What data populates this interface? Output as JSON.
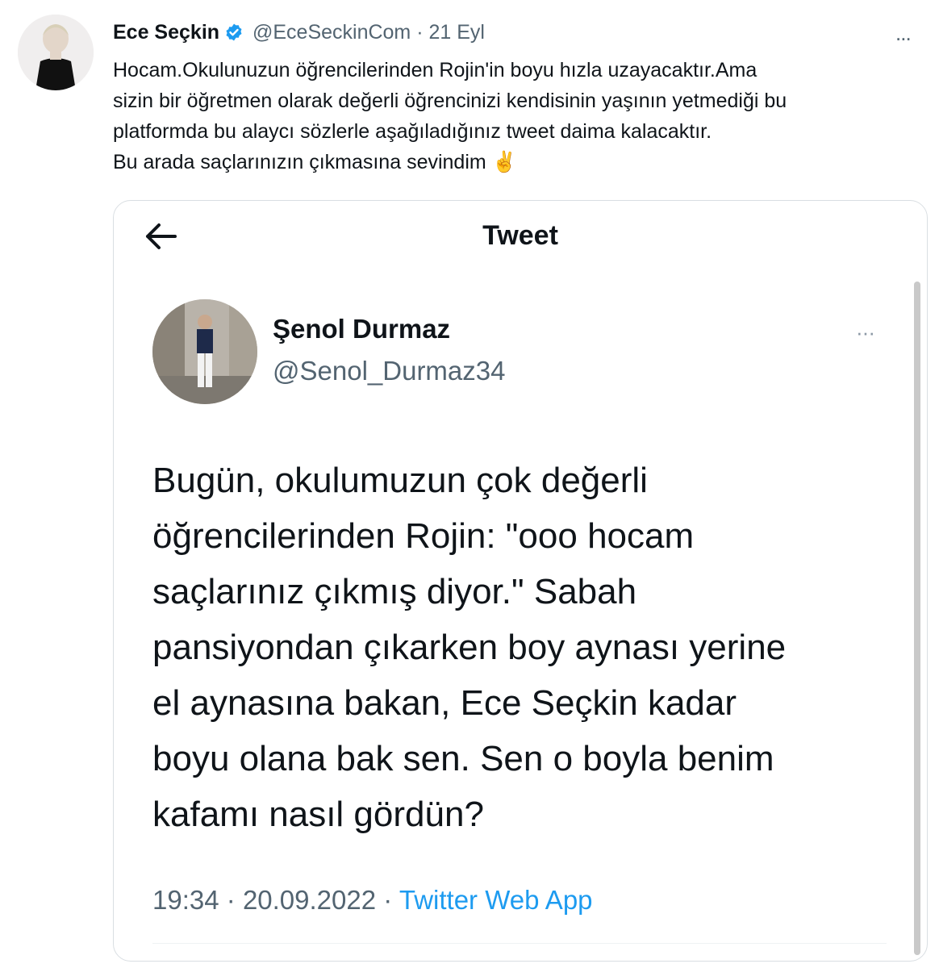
{
  "tweet": {
    "author_name": "Ece Seçkin",
    "handle": "@EceSeckinCom",
    "separator": "·",
    "date": "21 Eyl",
    "more_icon": "...",
    "lines": [
      "Hocam.Okulunuzun  öğrencilerinden Rojin'in boyu hızla uzayacaktır.Ama",
      "sizin bir öğretmen olarak değerli öğrencinizi kendisinin yaşının yetmediği bu",
      "platformda bu alaycı sözlerle aşağıladığınız tweet daima kalacaktır.",
      "Bu arada saçlarınızın çıkmasına sevindim ✌️"
    ]
  },
  "quoted": {
    "page_title": "Tweet",
    "author_name": "Şenol Durmaz",
    "handle": "@Senol_Durmaz34",
    "more_icon": "···",
    "lines": [
      "Bugün, okulumuzun çok değerli",
      "öğrencilerinden Rojin: \"ooo hocam",
      "saçlarınız çıkmış diyor.\" Sabah",
      "pansiyondan çıkarken boy aynası yerine",
      "el aynasına bakan, Ece Seçkin kadar",
      "boyu olana bak sen. Sen o boyla benim",
      "kafamı nasıl gördün?"
    ],
    "time": "19:34",
    "separator": "·",
    "date": "20.09.2022",
    "source": "Twitter Web App"
  },
  "colors": {
    "verified_badge": "#1d9bf0",
    "link": "#1d9bf0",
    "muted_text": "#536471",
    "border": "#d9dee2"
  },
  "icons": {
    "verified": "verified-badge-icon",
    "back": "arrow-left-icon",
    "more": "more-horizontal-icon"
  }
}
